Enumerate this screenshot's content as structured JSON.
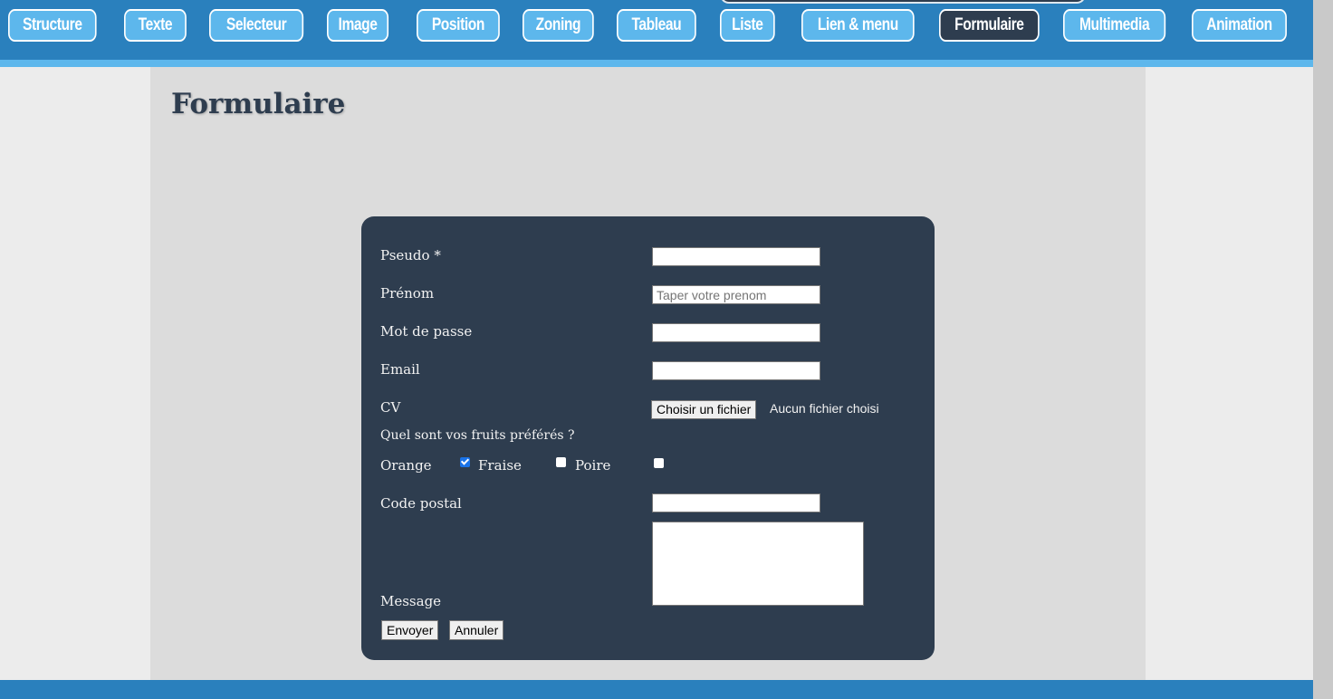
{
  "nav": {
    "items": [
      {
        "label": "Structure"
      },
      {
        "label": "Texte"
      },
      {
        "label": "Selecteur"
      },
      {
        "label": "Image"
      },
      {
        "label": "Position"
      },
      {
        "label": "Zoning"
      },
      {
        "label": "Tableau"
      },
      {
        "label": "Liste"
      },
      {
        "label": "Lien & menu"
      },
      {
        "label": "Formulaire",
        "active": true
      },
      {
        "label": "Multimedia"
      },
      {
        "label": "Animation"
      }
    ]
  },
  "page": {
    "title": "Formulaire"
  },
  "form": {
    "pseudo_label": "Pseudo *",
    "pseudo_value": "",
    "prenom_label": "Prénom",
    "prenom_placeholder": "Taper votre prenom",
    "password_label": "Mot de passe",
    "email_label": "Email",
    "cv_label": "CV",
    "file_button": "Choisir un fichier",
    "file_status": "Aucun fichier choisi",
    "fruits_question": "Quel sont vos fruits préférés ?",
    "fruits": [
      {
        "label": "Orange",
        "checked": true
      },
      {
        "label": "Fraise",
        "checked": false
      },
      {
        "label": "Poire",
        "checked": false
      }
    ],
    "postal_label": "Code postal",
    "message_label": "Message",
    "submit_label": "Envoyer",
    "reset_label": "Annuler"
  },
  "colors": {
    "nav_bg": "#2a80bd",
    "nav_button": "#5db7ec",
    "active_button": "#2e3d4f",
    "card_bg": "#2e3d4f"
  }
}
